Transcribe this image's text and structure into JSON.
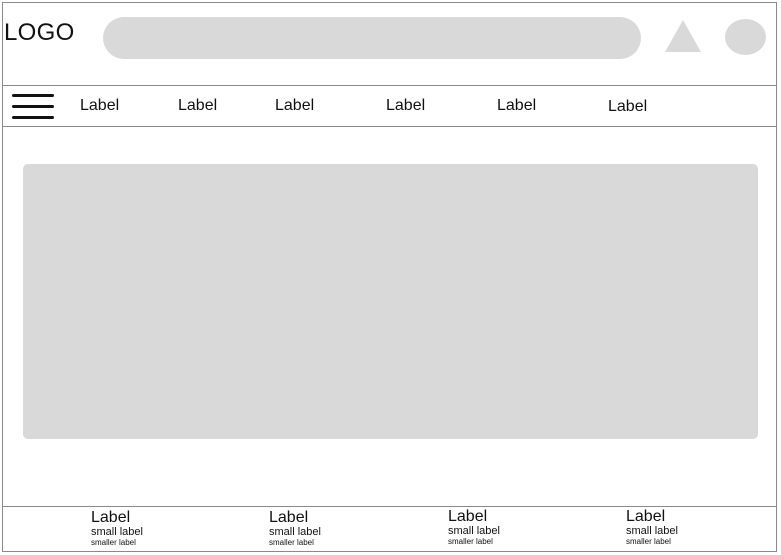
{
  "header": {
    "logo": "LOGO",
    "search": {
      "value": "",
      "placeholder": ""
    },
    "icons": [
      "triangle-icon",
      "avatar-circle"
    ]
  },
  "nav": {
    "menu_icon": "hamburger-icon",
    "items": [
      {
        "label": "Label"
      },
      {
        "label": "Label"
      },
      {
        "label": "Label"
      },
      {
        "label": "Label"
      },
      {
        "label": "Label"
      },
      {
        "label": "Label"
      }
    ]
  },
  "hero": {},
  "footer": {
    "columns": [
      {
        "label": "Label",
        "small": "small label",
        "smaller": "smaller label"
      },
      {
        "label": "Label",
        "small": "small label",
        "smaller": "smaller label"
      },
      {
        "label": "Label",
        "small": "small label",
        "smaller": "smaller label"
      },
      {
        "label": "Label",
        "small": "small label",
        "smaller": "smaller label"
      }
    ]
  },
  "colors": {
    "placeholder_fill": "#d9d9d9",
    "border": "#8a8a8a",
    "text": "#111111"
  }
}
